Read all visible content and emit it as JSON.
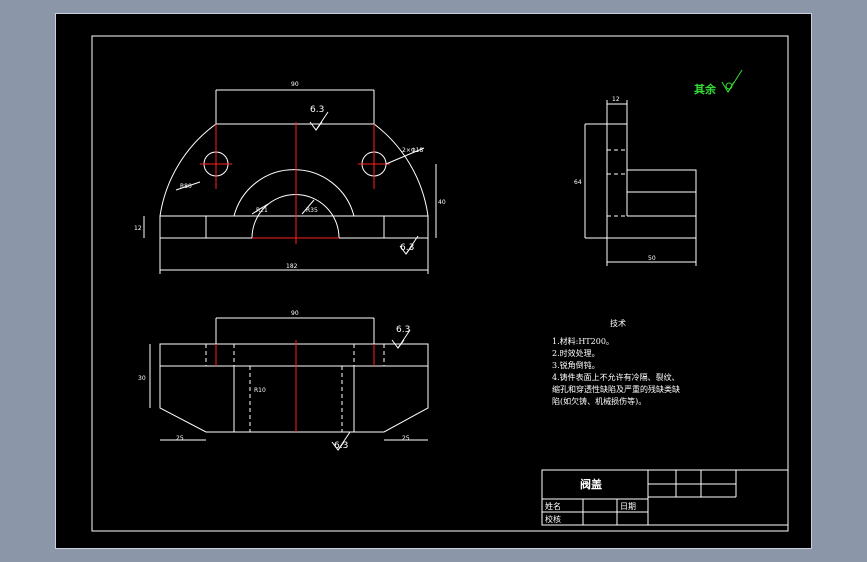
{
  "drawing": {
    "part_name": "阀盖",
    "general_roughness_label": "其余",
    "roughness_values": [
      "6.3",
      "6.3",
      "6.3",
      "6.3"
    ],
    "dimensions": {
      "front_top_width": "90",
      "front_total_width": "182",
      "front_left_height": "12",
      "front_right_height": "40",
      "radius_outer": "R80",
      "radius_inner": "R21",
      "radius_inner_b": "R35",
      "holes": "2×Φ18",
      "top_width": "90",
      "top_left_height": "30",
      "top_left_chamfer": "25",
      "top_right_chamfer": "25",
      "top_inner": "R10",
      "side_top": "12",
      "side_height": "64",
      "side_bottom": "50"
    },
    "notes_title": "技术",
    "notes": [
      "1.材料:HT200。",
      "2.时效处理。",
      "3.锐角倒钝。",
      "4.铸件表面上不允许有冷隔、裂纹、",
      "缩孔和穿透性缺陷及严重的残缺类缺",
      "陷(如欠铸、机械损伤等)。"
    ],
    "title_block": {
      "name": "阀盖",
      "row1_label": "姓名",
      "row1_date": "日期",
      "row2_label": "校核"
    }
  },
  "colors": {
    "background": "#000000",
    "outline": "#ffffff",
    "centerline": "#ff2020",
    "highlight": "#33dd33",
    "frame": "#8b96a8"
  }
}
